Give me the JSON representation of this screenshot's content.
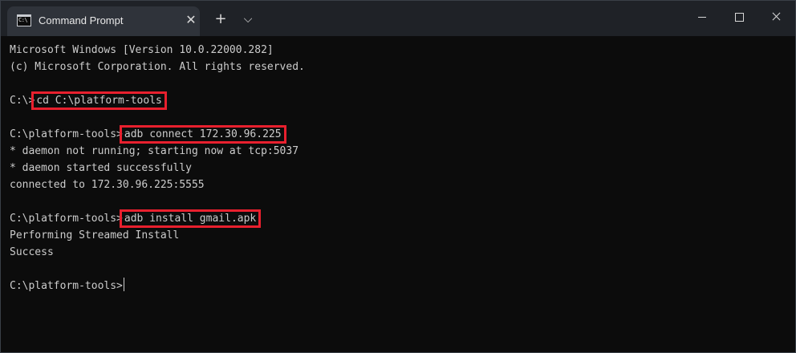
{
  "window": {
    "tab_title": "Command Prompt",
    "tab_icon": "cmd-icon",
    "tab_icon_text": "C:\\",
    "close_tab": "✕",
    "add_tab": "+",
    "dropdown": "⌵"
  },
  "console": {
    "lines": [
      "Microsoft Windows [Version 10.0.22000.282]",
      "(c) Microsoft Corporation. All rights reserved.",
      "",
      "",
      "",
      "* daemon not running; starting now at tcp:5037",
      "* daemon started successfully",
      "connected to 172.30.96.225:5555",
      "",
      "",
      "Performing Streamed Install",
      "Success",
      "",
      ""
    ],
    "commands": [
      {
        "prompt": "C:\\>",
        "command": "cd C:\\platform-tools"
      },
      {
        "prompt": "C:\\platform-tools>",
        "command": "adb connect 172.30.96.225"
      },
      {
        "prompt": "C:\\platform-tools>",
        "command": "adb install gmail.apk"
      }
    ],
    "final_prompt": "C:\\platform-tools>"
  },
  "colors": {
    "background": "#0c0c0c",
    "text": "#cccccc",
    "titlebar": "#1f2227",
    "tab": "#2f333a",
    "highlight": "#e8202e"
  }
}
